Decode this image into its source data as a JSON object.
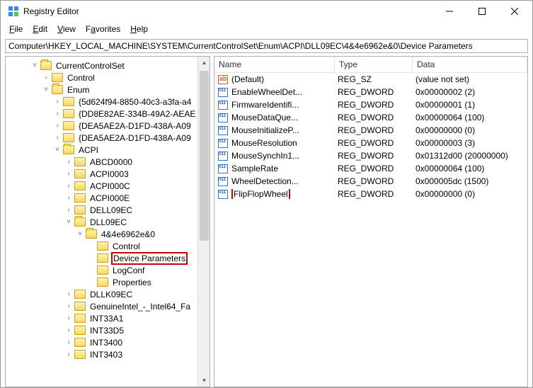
{
  "window": {
    "title": "Registry Editor"
  },
  "menu": {
    "file": "File",
    "edit": "Edit",
    "view": "View",
    "favorites": "Favorites",
    "help": "Help"
  },
  "addressbar": {
    "path": "Computer\\HKEY_LOCAL_MACHINE\\SYSTEM\\CurrentControlSet\\Enum\\ACPI\\DLL09EC\\4&4e6962e&0\\Device Parameters"
  },
  "tree": [
    {
      "depth": 1,
      "expander": "˅",
      "name": "CurrentControlSet",
      "open": true
    },
    {
      "depth": 2,
      "expander": "›",
      "name": "Control",
      "open": false
    },
    {
      "depth": 2,
      "expander": "˅",
      "name": "Enum",
      "open": true
    },
    {
      "depth": 3,
      "expander": "›",
      "name": "{5d624f94-8850-40c3-a3fa-a4",
      "open": false
    },
    {
      "depth": 3,
      "expander": "›",
      "name": "{DD8E82AE-334B-49A2-AEAE",
      "open": false
    },
    {
      "depth": 3,
      "expander": "›",
      "name": "{DEA5AE2A-D1FD-438A-A09",
      "open": false
    },
    {
      "depth": 3,
      "expander": "›",
      "name": "{DEA5AE2A-D1FD-438A-A09",
      "open": false
    },
    {
      "depth": 3,
      "expander": "˅",
      "name": "ACPI",
      "open": true
    },
    {
      "depth": 4,
      "expander": "›",
      "name": "ABCD0000",
      "open": false
    },
    {
      "depth": 4,
      "expander": "›",
      "name": "ACPI0003",
      "open": false
    },
    {
      "depth": 4,
      "expander": "›",
      "name": "ACPI000C",
      "open": false
    },
    {
      "depth": 4,
      "expander": "›",
      "name": "ACPI000E",
      "open": false
    },
    {
      "depth": 4,
      "expander": "›",
      "name": "DELL09EC",
      "open": false
    },
    {
      "depth": 4,
      "expander": "˅",
      "name": "DLL09EC",
      "open": true
    },
    {
      "depth": 5,
      "expander": "˅",
      "name": "4&4e6962e&0",
      "open": true
    },
    {
      "depth": 6,
      "expander": "",
      "name": "Control",
      "open": false
    },
    {
      "depth": 6,
      "expander": "",
      "name": "Device Parameters",
      "open": false,
      "highlighted": true
    },
    {
      "depth": 6,
      "expander": "",
      "name": "LogConf",
      "open": false
    },
    {
      "depth": 6,
      "expander": "",
      "name": "Properties",
      "open": false
    },
    {
      "depth": 4,
      "expander": "›",
      "name": "DLLK09EC",
      "open": false
    },
    {
      "depth": 4,
      "expander": "›",
      "name": "GenuineIntel_-_Intel64_Fa",
      "open": false
    },
    {
      "depth": 4,
      "expander": "›",
      "name": "INT33A1",
      "open": false
    },
    {
      "depth": 4,
      "expander": "›",
      "name": "INT33D5",
      "open": false
    },
    {
      "depth": 4,
      "expander": "›",
      "name": "INT3400",
      "open": false
    },
    {
      "depth": 4,
      "expander": "›",
      "name": "INT3403",
      "open": false
    }
  ],
  "columns": {
    "name": "Name",
    "type": "Type",
    "data": "Data"
  },
  "values": [
    {
      "icon": "sz",
      "name": "(Default)",
      "type": "REG_SZ",
      "data": "(value not set)"
    },
    {
      "icon": "dw",
      "name": "EnableWheelDet...",
      "type": "REG_DWORD",
      "data": "0x00000002 (2)"
    },
    {
      "icon": "dw",
      "name": "FirmwareIdentifi...",
      "type": "REG_DWORD",
      "data": "0x00000001 (1)"
    },
    {
      "icon": "dw",
      "name": "MouseDataQue...",
      "type": "REG_DWORD",
      "data": "0x00000064 (100)"
    },
    {
      "icon": "dw",
      "name": "MouseInitializeP...",
      "type": "REG_DWORD",
      "data": "0x00000000 (0)"
    },
    {
      "icon": "dw",
      "name": "MouseResolution",
      "type": "REG_DWORD",
      "data": "0x00000003 (3)"
    },
    {
      "icon": "dw",
      "name": "MouseSynchIn1...",
      "type": "REG_DWORD",
      "data": "0x01312d00 (20000000)"
    },
    {
      "icon": "dw",
      "name": "SampleRate",
      "type": "REG_DWORD",
      "data": "0x00000064 (100)"
    },
    {
      "icon": "dw",
      "name": "WheelDetection...",
      "type": "REG_DWORD",
      "data": "0x000005dc (1500)"
    },
    {
      "icon": "dw",
      "name": "FlipFlopWheel",
      "type": "REG_DWORD",
      "data": "0x00000000 (0)",
      "highlighted": true
    }
  ]
}
